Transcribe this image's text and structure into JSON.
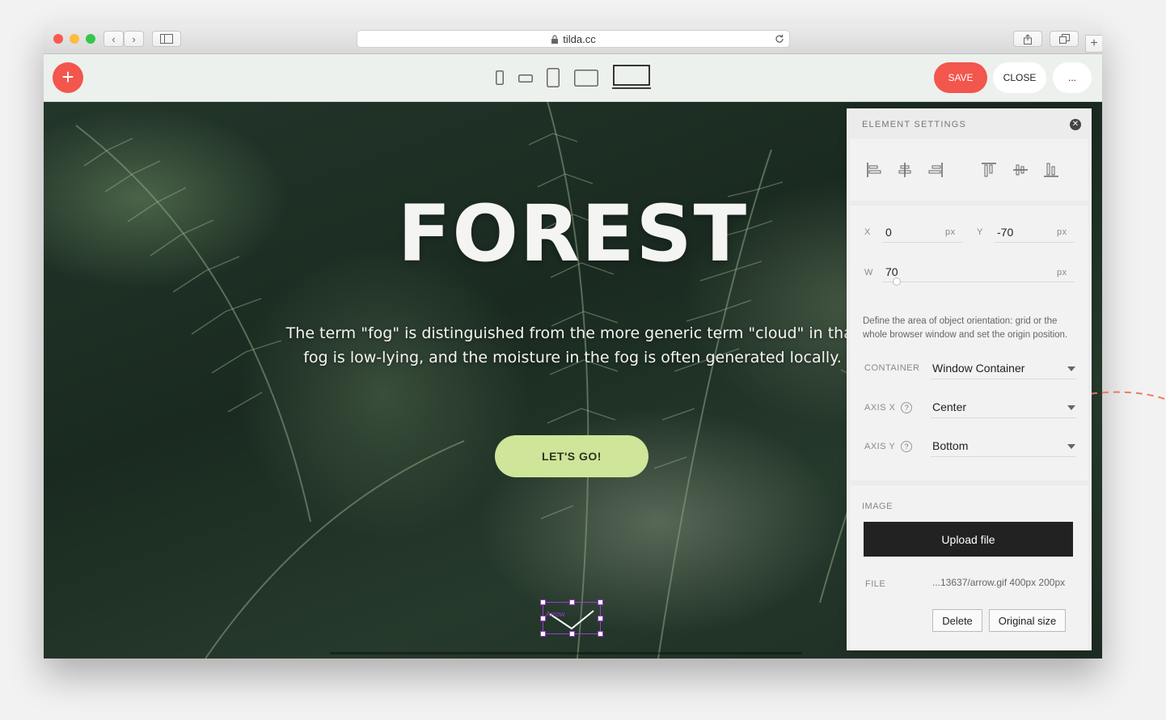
{
  "browser": {
    "url": "tilda.cc",
    "lights": [
      "#fc5753",
      "#fdbc40",
      "#33c748"
    ]
  },
  "toolbar": {
    "save_label": "SAVE",
    "close_label": "CLOSE",
    "more_label": "...",
    "accent_color": "#f2564c"
  },
  "hero": {
    "title": "FOREST",
    "text": "The term \"fog\" is distinguished from the more generic term \"cloud\" in that fog is low-lying, and the moisture in the fog is often generated locally.",
    "cta_label": "LET'S GO!",
    "cta_color": "#cfe59a",
    "element_label": "Arrow"
  },
  "panel": {
    "title": "ELEMENT SETTINGS",
    "position": {
      "x_label": "X",
      "x_value": "0",
      "x_unit": "px",
      "y_label": "Y",
      "y_value": "-70",
      "y_unit": "px",
      "w_label": "W",
      "w_value": "70",
      "w_unit": "px"
    },
    "description": "Define the area of object orientation: grid or the whole browser window and set the origin position.",
    "container_label": "CONTAINER",
    "container_value": "Window Container",
    "axis_x_label": "AXIS X",
    "axis_x_value": "Center",
    "axis_y_label": "AXIS Y",
    "axis_y_value": "Bottom",
    "help_glyph": "?",
    "image": {
      "section_label": "IMAGE",
      "upload_label": "Upload file",
      "file_label": "FILE",
      "file_value": "...13637/arrow.gif 400px 200px",
      "delete_label": "Delete",
      "original_size_label": "Original size"
    }
  },
  "annotation_color": "#f07b5a"
}
